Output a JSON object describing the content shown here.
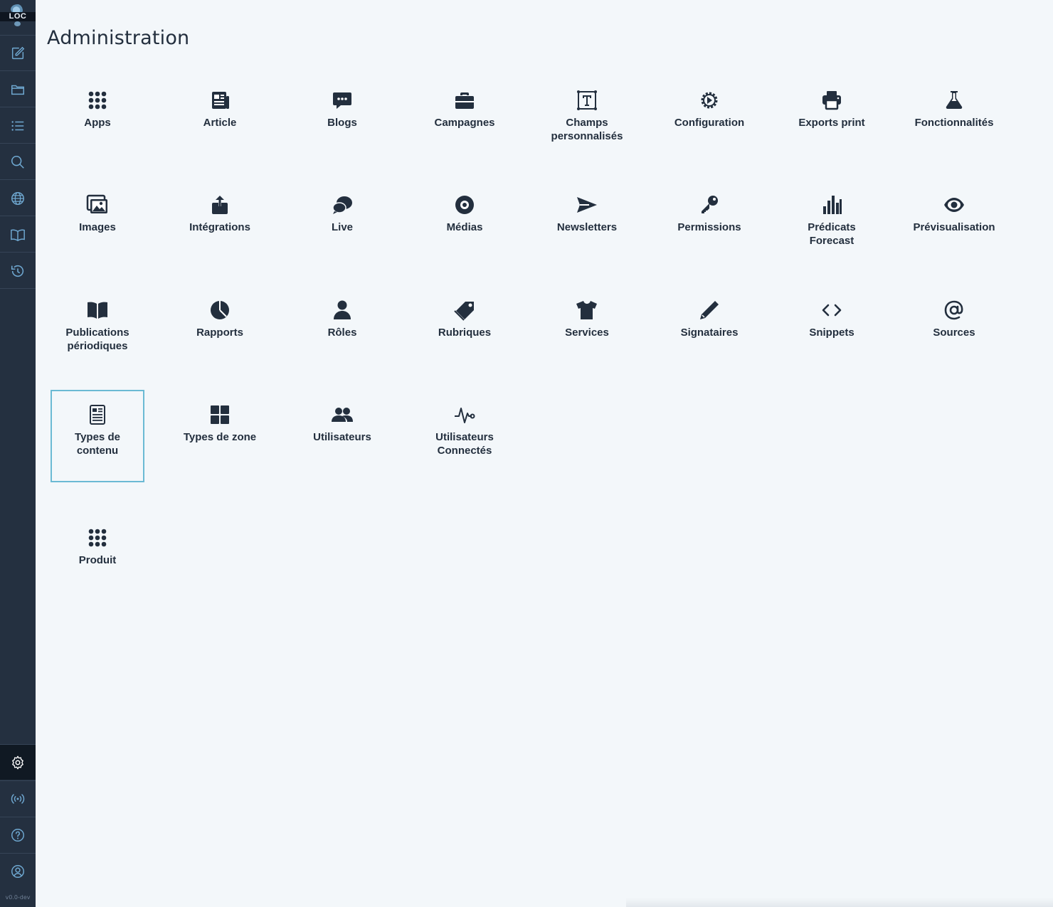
{
  "app": {
    "logo_text": "LOC",
    "version": "v0.0-dev",
    "page_title": "Administration"
  },
  "colors": {
    "sidebar_bg": "#243040",
    "sidebar_icon": "#6fa8d1",
    "page_bg": "#f3f7fa",
    "text": "#232f3e",
    "selected_border": "#6bbad4"
  },
  "sidebar": {
    "top_items": [
      {
        "icon": "edit-icon"
      },
      {
        "icon": "folder-icon"
      },
      {
        "icon": "list-icon"
      },
      {
        "icon": "search-icon"
      },
      {
        "icon": "globe-icon"
      },
      {
        "icon": "book-icon"
      },
      {
        "icon": "history-icon"
      }
    ],
    "bottom_items": [
      {
        "icon": "gear-icon",
        "active": true
      },
      {
        "icon": "broadcast-icon"
      },
      {
        "icon": "help-icon"
      },
      {
        "icon": "user-icon"
      }
    ]
  },
  "tiles": [
    {
      "label": "Apps",
      "icon": "grid-dots-icon"
    },
    {
      "label": "Article",
      "icon": "newspaper-icon"
    },
    {
      "label": "Blogs",
      "icon": "chat-bubble-icon"
    },
    {
      "label": "Campagnes",
      "icon": "briefcase-icon"
    },
    {
      "label": "Champs\npersonnalisés",
      "icon": "text-field-icon"
    },
    {
      "label": "Configuration",
      "icon": "gear-play-icon"
    },
    {
      "label": "Exports print",
      "icon": "printer-icon"
    },
    {
      "label": "Fonctionnalités",
      "icon": "flask-icon"
    },
    {
      "label": "Images",
      "icon": "images-icon"
    },
    {
      "label": "Intégrations",
      "icon": "upload-box-icon"
    },
    {
      "label": "Live",
      "icon": "comments-icon"
    },
    {
      "label": "Médias",
      "icon": "disc-icon"
    },
    {
      "label": "Newsletters",
      "icon": "send-icon"
    },
    {
      "label": "Permissions",
      "icon": "key-icon"
    },
    {
      "label": "Prédicats\nForecast",
      "icon": "bar-chart-icon"
    },
    {
      "label": "Prévisualisation",
      "icon": "eye-icon"
    },
    {
      "label": "Publications\npériodiques",
      "icon": "open-book-icon"
    },
    {
      "label": "Rapports",
      "icon": "pie-chart-icon"
    },
    {
      "label": "Rôles",
      "icon": "person-icon"
    },
    {
      "label": "Rubriques",
      "icon": "tags-icon"
    },
    {
      "label": "Services",
      "icon": "tshirt-icon"
    },
    {
      "label": "Signataires",
      "icon": "pencil-icon"
    },
    {
      "label": "Snippets",
      "icon": "code-icon"
    },
    {
      "label": "Sources",
      "icon": "at-icon"
    },
    {
      "label": "Types de\ncontenu",
      "icon": "document-icon",
      "selected": true
    },
    {
      "label": "Types de zone",
      "icon": "tiles-icon"
    },
    {
      "label": "Utilisateurs",
      "icon": "users-icon"
    },
    {
      "label": "Utilisateurs\nConnectés",
      "icon": "pulse-icon"
    },
    {
      "label": "Produit",
      "icon": "grid-dots-icon"
    }
  ]
}
